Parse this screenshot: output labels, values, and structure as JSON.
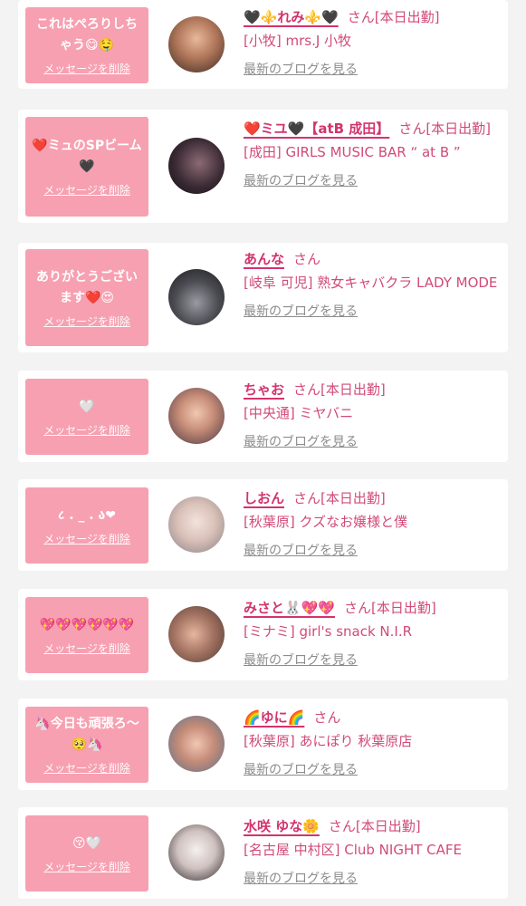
{
  "delete_label": "メッセージを削除",
  "blog_label": "最新のブログを見る",
  "colors": {
    "bubble": "#f7a0b1",
    "name": "#d2336d",
    "text": "#d24a78",
    "link": "#8c8c8c",
    "background": "#f3f3f3"
  },
  "messages": [
    {
      "message": "これはぺろりしちゃう😋🤤",
      "name": "🖤⚜️れみ⚜️🖤",
      "suffix": "さん[本日出勤]",
      "shop": "[小牧] mrs.J 小牧"
    },
    {
      "message": "❤️ミュのSPビーム🖤",
      "name": "❤️ミユ🖤【atB 成田】",
      "suffix": "さん[本日出勤]",
      "shop": "[成田] GIRLS MUSIC BAR “ at B ”"
    },
    {
      "message": "ありがとうございます❤️😍",
      "name": "あんな",
      "suffix": "さん",
      "shop": "[岐阜 可児] 熟女キャバクラ LADY MODE"
    },
    {
      "message": "🤍",
      "name": "ちゃお",
      "suffix": "さん[本日出勤]",
      "shop": "[中央通] ミヤバニ"
    },
    {
      "message": "८ . _ . ა❤",
      "name": "しおん",
      "suffix": "さん[本日出勤]",
      "shop": "[秋葉原] クズなお嬢様と僕"
    },
    {
      "message": "💖💖💖💖💖💖",
      "name": "みさと🐰💖💖",
      "suffix": "さん[本日出勤]",
      "shop": "[ミナミ] girl's snack N.I.R"
    },
    {
      "message": "🦄今日も頑張ろ〜🥺🦄",
      "name": "🌈ゆに🌈",
      "suffix": "さん",
      "shop": "[秋葉原] あにぽり 秋葉原店"
    },
    {
      "message": "😚🤍",
      "name": "水咲 ゆな🌼",
      "suffix": "さん[本日出勤]",
      "shop": "[名古屋 中村区] Club NIGHT CAFE"
    }
  ]
}
